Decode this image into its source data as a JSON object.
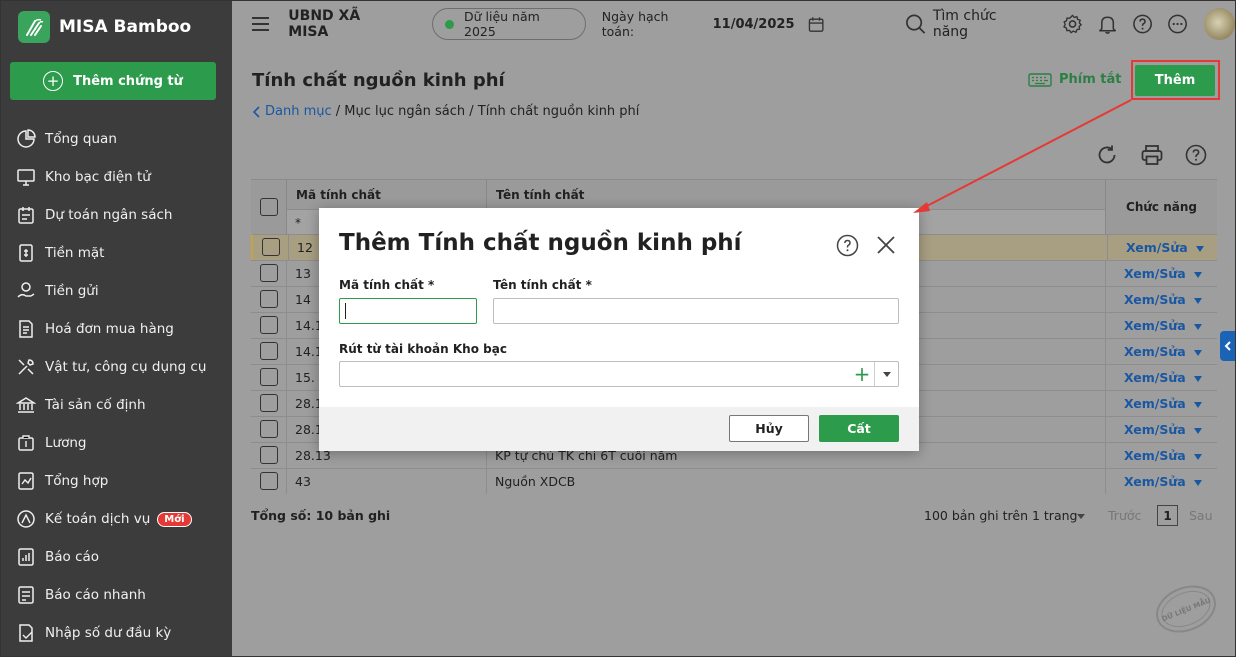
{
  "app": {
    "name": "MISA Bamboo",
    "add_voucher": "Thêm chứng từ"
  },
  "nav": [
    {
      "label": "Tổng quan",
      "icon": "pie-chart-icon"
    },
    {
      "label": "Kho bạc điện tử",
      "icon": "monitor-icon"
    },
    {
      "label": "Dự toán ngân sách",
      "icon": "budget-icon"
    },
    {
      "label": "Tiền mặt",
      "icon": "cash-icon"
    },
    {
      "label": "Tiền gửi",
      "icon": "deposit-icon"
    },
    {
      "label": "Hoá đơn mua hàng",
      "icon": "invoice-icon"
    },
    {
      "label": "Vật tư, công cụ dụng cụ",
      "icon": "tools-icon"
    },
    {
      "label": "Tài sản cố định",
      "icon": "bank-icon"
    },
    {
      "label": "Lương",
      "icon": "salary-icon"
    },
    {
      "label": "Tổng hợp",
      "icon": "summary-icon"
    },
    {
      "label": "Kế toán dịch vụ",
      "icon": "service-icon",
      "badge": "Mới"
    },
    {
      "label": "Báo cáo",
      "icon": "report-icon"
    },
    {
      "label": "Báo cáo nhanh",
      "icon": "quick-report-icon"
    },
    {
      "label": "Nhập số dư đầu kỳ",
      "icon": "opening-balance-icon"
    }
  ],
  "topbar": {
    "org": "UBND XÃ MISA",
    "data_year": "Dữ liệu năm 2025",
    "post_date_label": "Ngày hạch toán:",
    "post_date": "11/04/2025",
    "search": "Tìm chức năng"
  },
  "page": {
    "title": "Tính chất nguồn kinh phí",
    "breadcrumb_link": "Danh mục",
    "breadcrumb_rest": " / Mục lục ngân sách / Tính chất nguồn kinh phí",
    "shortcut": "Phím tắt",
    "add": "Thêm"
  },
  "grid": {
    "columns": {
      "code": "Mã tính chất",
      "name": "Tên tính chất",
      "func": "Chức năng"
    },
    "filter": "*",
    "action": "Xem/Sửa",
    "rows": [
      {
        "code": "12",
        "name": ""
      },
      {
        "code": "13",
        "name": ""
      },
      {
        "code": "14",
        "name": ""
      },
      {
        "code": "14.1",
        "name": ""
      },
      {
        "code": "14.1",
        "name": ""
      },
      {
        "code": "15.",
        "name": ""
      },
      {
        "code": "28.1",
        "name": ""
      },
      {
        "code": "28.1",
        "name": ""
      },
      {
        "code": "28.13",
        "name": "KP tự chủ TK chi 6T cuối năm"
      },
      {
        "code": "43",
        "name": "Nguồn XDCB"
      }
    ],
    "total": "Tổng số: 10 bản ghi",
    "page_size": "100 bản ghi trên 1 trang",
    "prev": "Trước",
    "page": "1",
    "next": "Sau"
  },
  "modal": {
    "title": "Thêm Tính chất nguồn kinh phí",
    "code_label": "Mã tính chất *",
    "name_label": "Tên tính chất *",
    "account_label": "Rút từ tài khoản Kho bạc",
    "code_value": "",
    "name_value": "",
    "account_value": "",
    "cancel": "Hủy",
    "save": "Cất"
  },
  "watermark": "DỮ LIỆU MẪU",
  "colors": {
    "primary": "#2c9b4c",
    "link": "#1a57a3",
    "highlight": "#e53935",
    "sidebar": "#3c3c3c"
  }
}
